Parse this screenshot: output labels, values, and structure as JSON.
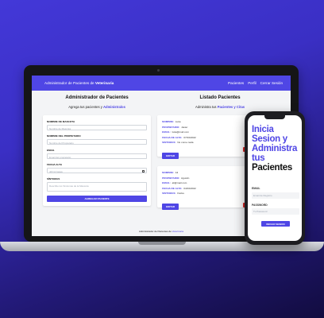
{
  "app": {
    "brand_prefix": "Administrador de Pacientes de ",
    "brand_highlight": "Veterinaria",
    "nav": [
      "Pacientes",
      "Perfil",
      "Cerrar Sesión"
    ]
  },
  "form_section": {
    "title": "Administrador de Pacientes",
    "subtitle_prefix": "Agrega tus pacientes y ",
    "subtitle_accent": "Administralos",
    "fields": [
      {
        "label": "NOMBRE DE MASCOTA",
        "placeholder": "Nombre de Mascota"
      },
      {
        "label": "NOMBRE DEL PROPIETARIO",
        "placeholder": "Nombre del Propietario"
      },
      {
        "label": "EMAIL",
        "placeholder": "Email del propietario"
      },
      {
        "label": "FECHA ALTA",
        "placeholder": "dd/mm/aaaa"
      },
      {
        "label": "SÍNTOMAS",
        "placeholder": "Describe los Síntomas de la Mascota"
      }
    ],
    "submit_label": "AGREGAR PACIENTE"
  },
  "list_section": {
    "title": "Listado Pacientes",
    "subtitle_prefix": "Administra tus ",
    "subtitle_accent": "Pacientes y Citas",
    "patients": [
      {
        "rows": [
          {
            "k": "NOMBRE:",
            "v": "Luka"
          },
          {
            "k": "PROPIETARIO:",
            "v": "Javier"
          },
          {
            "k": "EMAIL:",
            "v": "luka@mail.com"
          },
          {
            "k": "FECHA DE ALTA:",
            "v": "07/04/2022"
          },
          {
            "k": "SINTOMAS:",
            "v": "No come nada"
          }
        ],
        "edit_label": "EDITAR"
      },
      {
        "rows": [
          {
            "k": "NOMBRE:",
            "v": "Ali"
          },
          {
            "k": "PROPIETARIO:",
            "v": "Agustin"
          },
          {
            "k": "EMAIL:",
            "v": "ali@mail.com"
          },
          {
            "k": "FECHA DE ALTA:",
            "v": "04/04/2022"
          },
          {
            "k": "SINTOMAS:",
            "v": "Fiebre"
          }
        ],
        "edit_label": "EDITAR"
      }
    ]
  },
  "footer": {
    "prefix": "Administrador de Pacientes de ",
    "accent": "Veterinaria"
  },
  "phone": {
    "title_accent": "Inicia Sesion y Administra tus",
    "title_dark": "Pacientes",
    "email_label": "EMAIL",
    "email_placeholder": "Email de Registro",
    "password_label": "PASSWORD",
    "password_placeholder": "Tu Password",
    "login_label": "INICIAR SESION"
  },
  "colors": {
    "accent": "#4f46e5",
    "delete": "#dc2626",
    "background": "#3a2fc4"
  }
}
